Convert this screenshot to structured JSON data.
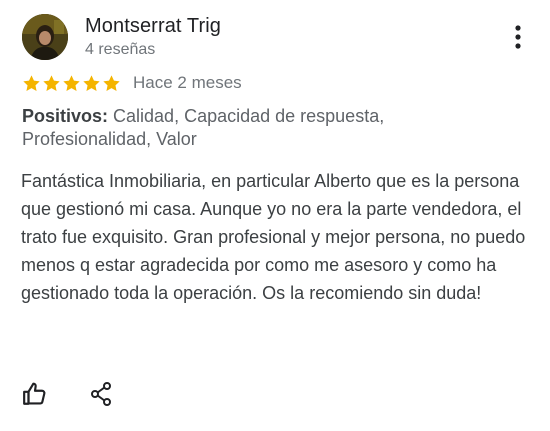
{
  "review": {
    "author": {
      "name": "Montserrat Trig",
      "review_count": "4 reseñas",
      "avatar": "profile-photo"
    },
    "rating": 5,
    "rating_max": 5,
    "date": "Hace 2 meses",
    "positives": {
      "label": "Positivos:",
      "values": " Calidad, Capacidad de respuesta, Profesionalidad, Valor"
    },
    "text": "Fantástica Inmobiliaria, en particular Alberto que es la persona que gestionó mi casa. Aunque yo no era la parte vendedora, el trato fue exquisito. Gran profesional y mejor persona, no puedo menos q estar agradecida por como me asesoro y como ha gestionado toda la operación. Os la recomiendo sin duda!"
  },
  "actions": {
    "like_icon": "thumb-up-icon",
    "share_icon": "share-icon"
  },
  "menu": {
    "icon": "more-vert-icon"
  },
  "colors": {
    "star": "#f4b400",
    "text_primary": "#202124",
    "text_secondary": "#70757a",
    "icon": "#202124"
  }
}
